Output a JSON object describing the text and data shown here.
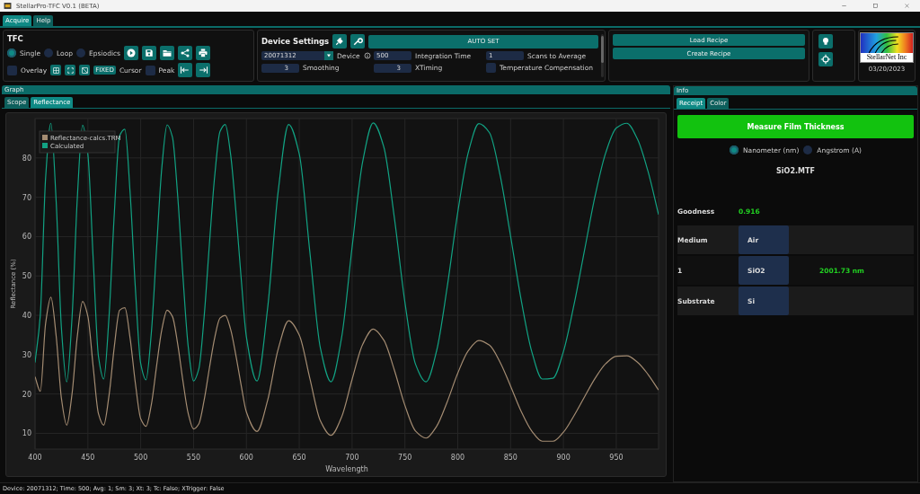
{
  "window": {
    "title": "StellarPro-TFC V0.1 (BETA)"
  },
  "menu_tabs": [
    {
      "label": "Acquire",
      "selected": true
    },
    {
      "label": "Help",
      "selected": false
    }
  ],
  "tfc": {
    "title": "TFC",
    "modes": [
      {
        "label": "Single",
        "selected": true
      },
      {
        "label": "Loop",
        "selected": false
      },
      {
        "label": "Epsiodics",
        "selected": false
      }
    ],
    "overlay": {
      "label": "Overlay",
      "checked": false
    },
    "fixed_button": "FIXED",
    "cursor_label": "Cursor",
    "peak": {
      "label": "Peak",
      "checked": false
    }
  },
  "device_settings": {
    "title": "Device Settings",
    "auto_set": "AUTO SET",
    "device": {
      "value": "20071312",
      "label": "Device"
    },
    "integration_time": {
      "value": "500",
      "label": "Integration Time"
    },
    "scans_to_average": {
      "value": "1",
      "label": "Scans to Average"
    },
    "smoothing": {
      "value": "3",
      "label": "Smoothing"
    },
    "xtiming": {
      "value": "3",
      "label": "XTiming"
    },
    "temperature_compensation": {
      "label": "Temperature Compensation",
      "checked": false
    }
  },
  "recipe_buttons": [
    "Load Recipe",
    "Create Recipe"
  ],
  "logo": {
    "text": "StellarNet Inc"
  },
  "date": "03/20/2023",
  "graph": {
    "title": "Graph",
    "tabs": [
      {
        "label": "Scope",
        "selected": false
      },
      {
        "label": "Reflectance",
        "selected": true
      }
    ],
    "chart_data": {
      "type": "line",
      "grid": true,
      "legend": true,
      "xlabel": "Wavelength",
      "ylabel": "Reflectance (%)",
      "xlim": [
        400,
        990
      ],
      "ylim": [
        6,
        90
      ],
      "xticks": [
        400,
        450,
        500,
        550,
        600,
        650,
        700,
        750,
        800,
        850,
        900,
        950
      ],
      "yticks": [
        10,
        20,
        30,
        40,
        50,
        60,
        70,
        80
      ],
      "x": [
        400,
        405,
        410,
        415,
        420,
        425,
        430,
        435,
        440,
        445,
        450,
        455,
        460,
        465,
        470,
        475,
        480,
        485,
        490,
        495,
        500,
        505,
        510,
        515,
        520,
        525,
        530,
        535,
        540,
        545,
        550,
        555,
        560,
        565,
        570,
        575,
        580,
        585,
        590,
        595,
        600,
        610,
        620,
        630,
        640,
        650,
        660,
        670,
        680,
        690,
        700,
        710,
        720,
        730,
        740,
        750,
        760,
        770,
        780,
        790,
        800,
        810,
        820,
        830,
        840,
        850,
        860,
        870,
        880,
        890,
        900,
        910,
        920,
        930,
        940,
        950,
        960,
        970,
        980,
        990
      ],
      "series": [
        {
          "name": "Reflectance-calcs.TRM",
          "color": "#a48c72",
          "values": [
            24.4,
            20.7,
            37.9,
            44.6,
            34.7,
            18.8,
            12.1,
            20.0,
            34.7,
            43.5,
            39.7,
            27.0,
            15.0,
            12.1,
            19.6,
            32.0,
            41.3,
            41.9,
            34.1,
            22.6,
            13.7,
            11.8,
            17.2,
            27.1,
            36.4,
            41.3,
            39.7,
            32.7,
            23.2,
            15.0,
            11.1,
            12.4,
            18.4,
            26.6,
            34.3,
            39.3,
            40.0,
            36.5,
            29.9,
            22.3,
            15.4,
            10.5,
            18.3,
            31.3,
            38.6,
            35.0,
            24.0,
            13.2,
            9.5,
            14.1,
            23.7,
            32.6,
            36.5,
            33.7,
            26.1,
            17.1,
            10.6,
            8.8,
            11.8,
            18.0,
            25.3,
            31.0,
            33.6,
            32.4,
            28.1,
            22.0,
            15.6,
            10.6,
            8.0,
            8.0,
            10.3,
            14.5,
            19.3,
            24.0,
            27.7,
            29.6,
            29.7,
            28.1,
            25.0,
            21.0
          ]
        },
        {
          "name": "Calculated",
          "color": "#12a283",
          "values": [
            28.0,
            40.1,
            74.9,
            88.8,
            68.9,
            36.6,
            23.1,
            39.4,
            69.8,
            88.3,
            80.9,
            54.5,
            29.6,
            23.8,
            39.6,
            65.8,
            85.6,
            87.3,
            71.0,
            46.6,
            27.7,
            23.6,
            35.4,
            57.0,
            77.6,
            88.4,
            85.3,
            70.3,
            49.7,
            31.9,
            23.3,
            26.4,
            39.6,
            58.1,
            75.4,
            86.7,
            88.5,
            81.0,
            66.6,
            49.6,
            34.5,
            23.3,
            41.6,
            71.3,
            88.5,
            81.0,
            56.2,
            31.7,
            23.1,
            34.2,
            57.3,
            79.0,
            88.9,
            82.8,
            64.8,
            43.3,
            27.6,
            23.1,
            31.0,
            47.2,
            66.2,
            81.4,
            88.7,
            86.4,
            75.7,
            60.1,
            43.9,
            30.8,
            23.8,
            24.0,
            30.8,
            42.7,
            56.6,
            70.4,
            81.3,
            87.6,
            88.8,
            84.8,
            76.6,
            65.6
          ]
        }
      ]
    }
  },
  "info": {
    "title": "Info",
    "tabs": [
      {
        "label": "Receipt",
        "selected": true
      },
      {
        "label": "Color",
        "selected": false
      }
    ],
    "measure_button": "Measure Film Thickness",
    "units": [
      {
        "label": "Nanometer (nm)",
        "selected": true
      },
      {
        "label": "Angstrom (A)",
        "selected": false
      }
    ],
    "recipe_file": "SiO2.MTF",
    "goodness": {
      "label": "Goodness",
      "value": "0.916"
    },
    "layers": [
      {
        "name": "Medium",
        "material": "Air"
      },
      {
        "name": "1",
        "material": "SiO2",
        "thickness": "2001.73 nm"
      },
      {
        "name": "Substrate",
        "material": "Si"
      }
    ]
  },
  "status_bar": "Device: 20071312; Time: 500; Avg: 1; Sm: 3; Xt: 3; Tc: False; XTrigger: False"
}
